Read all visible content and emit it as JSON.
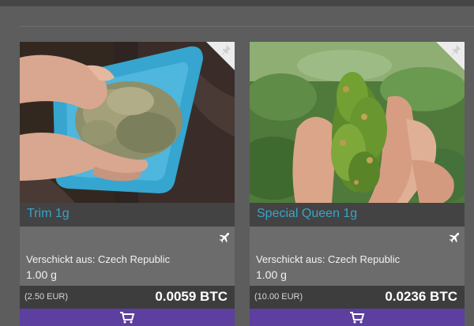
{
  "products": [
    {
      "title": "Trim 1g",
      "shipping": "Verschickt aus: Czech Republic",
      "quantity": "1.00 g",
      "price_eur": "(2.50 EUR)",
      "price_btc": "0.0059 BTC",
      "image": "hands-holding-trim-on-blue-plate"
    },
    {
      "title": "Special Queen 1g",
      "shipping": "Verschickt aus: Czech Republic",
      "quantity": "1.00 g",
      "price_eur": "(10.00 EUR)",
      "price_btc": "0.0236 BTC",
      "image": "hand-holding-bud-with-plants-background"
    }
  ],
  "icons": {
    "shipping": "airplane-icon",
    "cart": "cart-icon",
    "corner": "pin-icon"
  },
  "colors": {
    "title": "#3aa3c8",
    "cart_bar": "#5c3f9e",
    "price_bar": "#3d3d3d"
  }
}
